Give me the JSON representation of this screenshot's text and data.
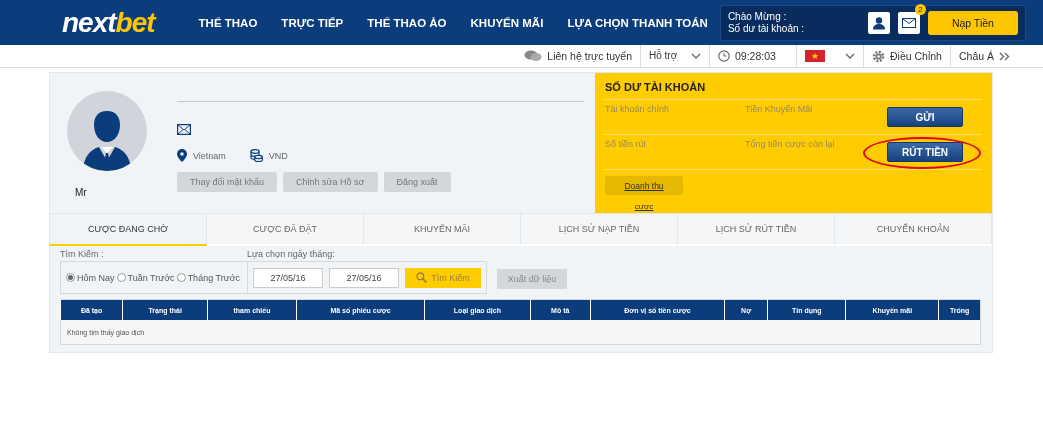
{
  "header": {
    "logo_parts": [
      "next",
      "bet"
    ],
    "nav": [
      "THỂ THAO",
      "TRỰC TIẾP",
      "THỂ THAO ẢO",
      "KHUYẾN MÃI",
      "LỰA CHỌN THANH TOÁN"
    ],
    "welcome_label": "Chào Mừng :",
    "balance_label": "Số dư tài khoản :",
    "mail_badge": "2",
    "deposit_button": "Nạp Tiền"
  },
  "toolbar": {
    "live_chat": "Liên hệ trực tuyến",
    "support": "Hỗ trợ",
    "time": "09:28:03",
    "settings": "Điều Chỉnh",
    "odds": "Châu Á"
  },
  "profile": {
    "title": "Mr",
    "country": "Vietnam",
    "currency": "VND",
    "buttons": [
      "Thay đổi mật khẩu",
      "Chỉnh sửa Hồ sơ",
      "Đăng xuất"
    ]
  },
  "balance": {
    "title": "SỐ DƯ TÀI KHOẢN",
    "rows": [
      {
        "labels": [
          "Tài khoản chính",
          "Tiền Khuyến Mãi"
        ],
        "button": "GỬI",
        "highlighted": false
      },
      {
        "labels": [
          "Số tiền rút",
          "Tổng tiền cược còn lại"
        ],
        "button": "RÚT TIỀN",
        "highlighted": true
      }
    ],
    "turnover_button": "Doanh thu",
    "turnover_link": "cược"
  },
  "tabs": [
    {
      "label": "CƯỢC ĐANG CHỜ",
      "selected": true
    },
    {
      "label": "CƯỢC ĐÃ ĐẶT",
      "selected": false
    },
    {
      "label": "KHUYẾN MÃI",
      "selected": false
    },
    {
      "label": "LỊCH SỬ NẠP TIỀN",
      "selected": false
    },
    {
      "label": "LỊCH SỬ RÚT TIỀN",
      "selected": false
    },
    {
      "label": "CHUYỂN KHOẢN",
      "selected": false
    }
  ],
  "search": {
    "label": "Tìm Kiếm :",
    "periods": [
      {
        "label": "Hôm Nay",
        "selected": true
      },
      {
        "label": "Tuần Trước",
        "selected": false
      },
      {
        "label": "Tháng Trước",
        "selected": false
      }
    ],
    "date_label": "Lựa chọn ngày tháng:",
    "date_from": "27/05/16",
    "date_to": "27/05/16",
    "search_button": "Tìm Kiếm",
    "export_button": "Xuất dữ liệu",
    "export_disabled": true
  },
  "table": {
    "columns": [
      "Đã tạo",
      "Trạng thái",
      "tham chiếu",
      "Mã số phiếu cược",
      "Loại giao dịch",
      "Mô tả",
      "Đơn vị số tiền cược",
      "Nợ",
      "Tín dụng",
      "Khuyến mãi",
      "Trống"
    ],
    "empty_message": "Không tìm thấy giao dịch"
  }
}
